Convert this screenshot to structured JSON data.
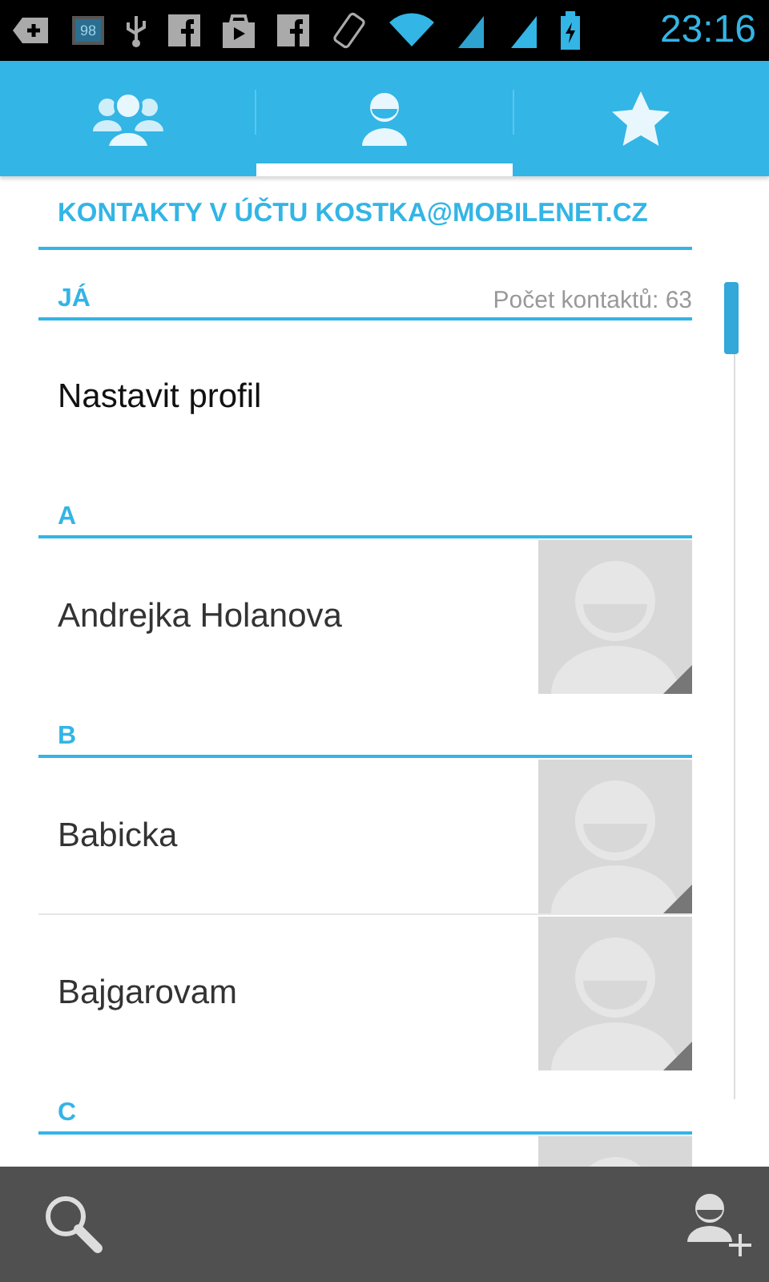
{
  "status_bar": {
    "battery_notice": "98",
    "time": "23:16"
  },
  "tabs": [
    {
      "kind": "groups",
      "selected": false
    },
    {
      "kind": "person",
      "selected": true
    },
    {
      "kind": "star",
      "selected": false
    }
  ],
  "account_header": "KONTAKTY V ÚČTU KOSTKA@MOBILENET.CZ",
  "me_section": {
    "title": "JÁ",
    "count": "Počet kontaktů: 63",
    "profile": "Nastavit profil"
  },
  "sections": [
    {
      "letter": "A",
      "contacts": [
        {
          "name": "Andrejka Holanova"
        }
      ]
    },
    {
      "letter": "B",
      "contacts": [
        {
          "name": "Babicka"
        },
        {
          "name": "Bajgarovam"
        }
      ]
    },
    {
      "letter": "C",
      "contacts": [
        {
          "photo_only": true
        }
      ]
    }
  ],
  "bottom_bar": [
    {
      "kind": "search"
    },
    {
      "kind": "add-contact"
    }
  ]
}
